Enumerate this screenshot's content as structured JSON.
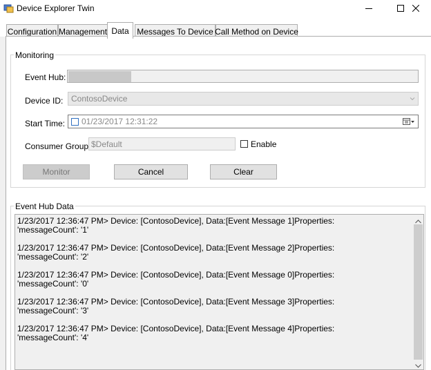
{
  "window": {
    "title": "Device Explorer Twin",
    "minimize_icon": "minimize-icon",
    "maximize_icon": "maximize-icon",
    "close_icon": "close-icon"
  },
  "tabs": [
    {
      "label": "Configuration",
      "active": false
    },
    {
      "label": "Management",
      "active": false
    },
    {
      "label": "Data",
      "active": true
    },
    {
      "label": "Messages To Device",
      "active": false
    },
    {
      "label": "Call Method on Device",
      "active": false
    }
  ],
  "monitoring": {
    "group_label": "Monitoring",
    "event_hub_label": "Event Hub:",
    "event_hub_progress": 0.18,
    "device_id_label": "Device ID:",
    "device_id_value": "ContosoDevice",
    "start_time_label": "Start Time:",
    "start_time_value": "01/23/2017 12:31:22",
    "consumer_group_label": "Consumer Group:",
    "consumer_group_value": "$Default",
    "enable_label": "Enable",
    "monitor_button": "Monitor",
    "cancel_button": "Cancel",
    "clear_button": "Clear"
  },
  "event_hub_data": {
    "group_label": "Event Hub Data",
    "entries": [
      {
        "line1": "1/23/2017 12:36:47 PM> Device: [ContosoDevice], Data:[Event Message 1]Properties:",
        "line2": "'messageCount': '1'"
      },
      {
        "line1": "1/23/2017 12:36:47 PM> Device: [ContosoDevice], Data:[Event Message 2]Properties:",
        "line2": "'messageCount': '2'"
      },
      {
        "line1": "1/23/2017 12:36:47 PM> Device: [ContosoDevice], Data:[Event Message 0]Properties:",
        "line2": "'messageCount': '0'"
      },
      {
        "line1": "1/23/2017 12:36:47 PM> Device: [ContosoDevice], Data:[Event Message 3]Properties:",
        "line2": "'messageCount': '3'"
      },
      {
        "line1": "1/23/2017 12:36:47 PM> Device: [ContosoDevice], Data:[Event Message 4]Properties:",
        "line2": "'messageCount': '4'"
      }
    ]
  }
}
